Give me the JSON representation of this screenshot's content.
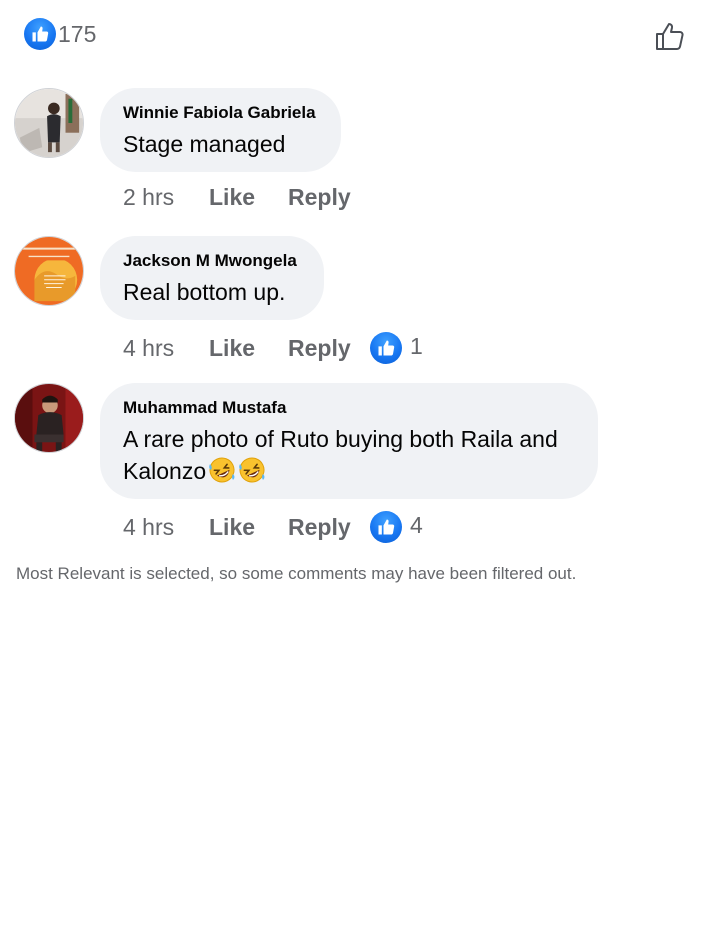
{
  "header": {
    "reactions_count": "175"
  },
  "comments": [
    {
      "author": "Winnie Fabiola Gabriela",
      "text": "Stage managed",
      "time": "2 hrs",
      "like_label": "Like",
      "reply_label": "Reply",
      "reaction_count": ""
    },
    {
      "author": "Jackson M Mwongela",
      "text": "Real bottom up.",
      "time": "4 hrs",
      "like_label": "Like",
      "reply_label": "Reply",
      "reaction_count": "1"
    },
    {
      "author": "Muhammad Mustafa",
      "text_line1": "A rare photo of Ruto buying both Raila and",
      "text_line2": "Kalonzo",
      "text_emojis": [
        "rolling-on-floor-laughing-emoji",
        "rolling-on-floor-laughing-emoji"
      ],
      "time": "4 hrs",
      "like_label": "Like",
      "reply_label": "Reply",
      "reaction_count": "4"
    }
  ],
  "footer": {
    "note": "Most Relevant is selected, so some comments may have been filtered out."
  },
  "colors": {
    "like_blue": "#1877f2",
    "bubble_bg": "#f0f2f5",
    "secondary_text": "#65676b",
    "primary_text": "#050505"
  },
  "icons": {
    "reaction_badge": "like-thumb-icon",
    "like_button": "thumb-up-outline-icon"
  }
}
